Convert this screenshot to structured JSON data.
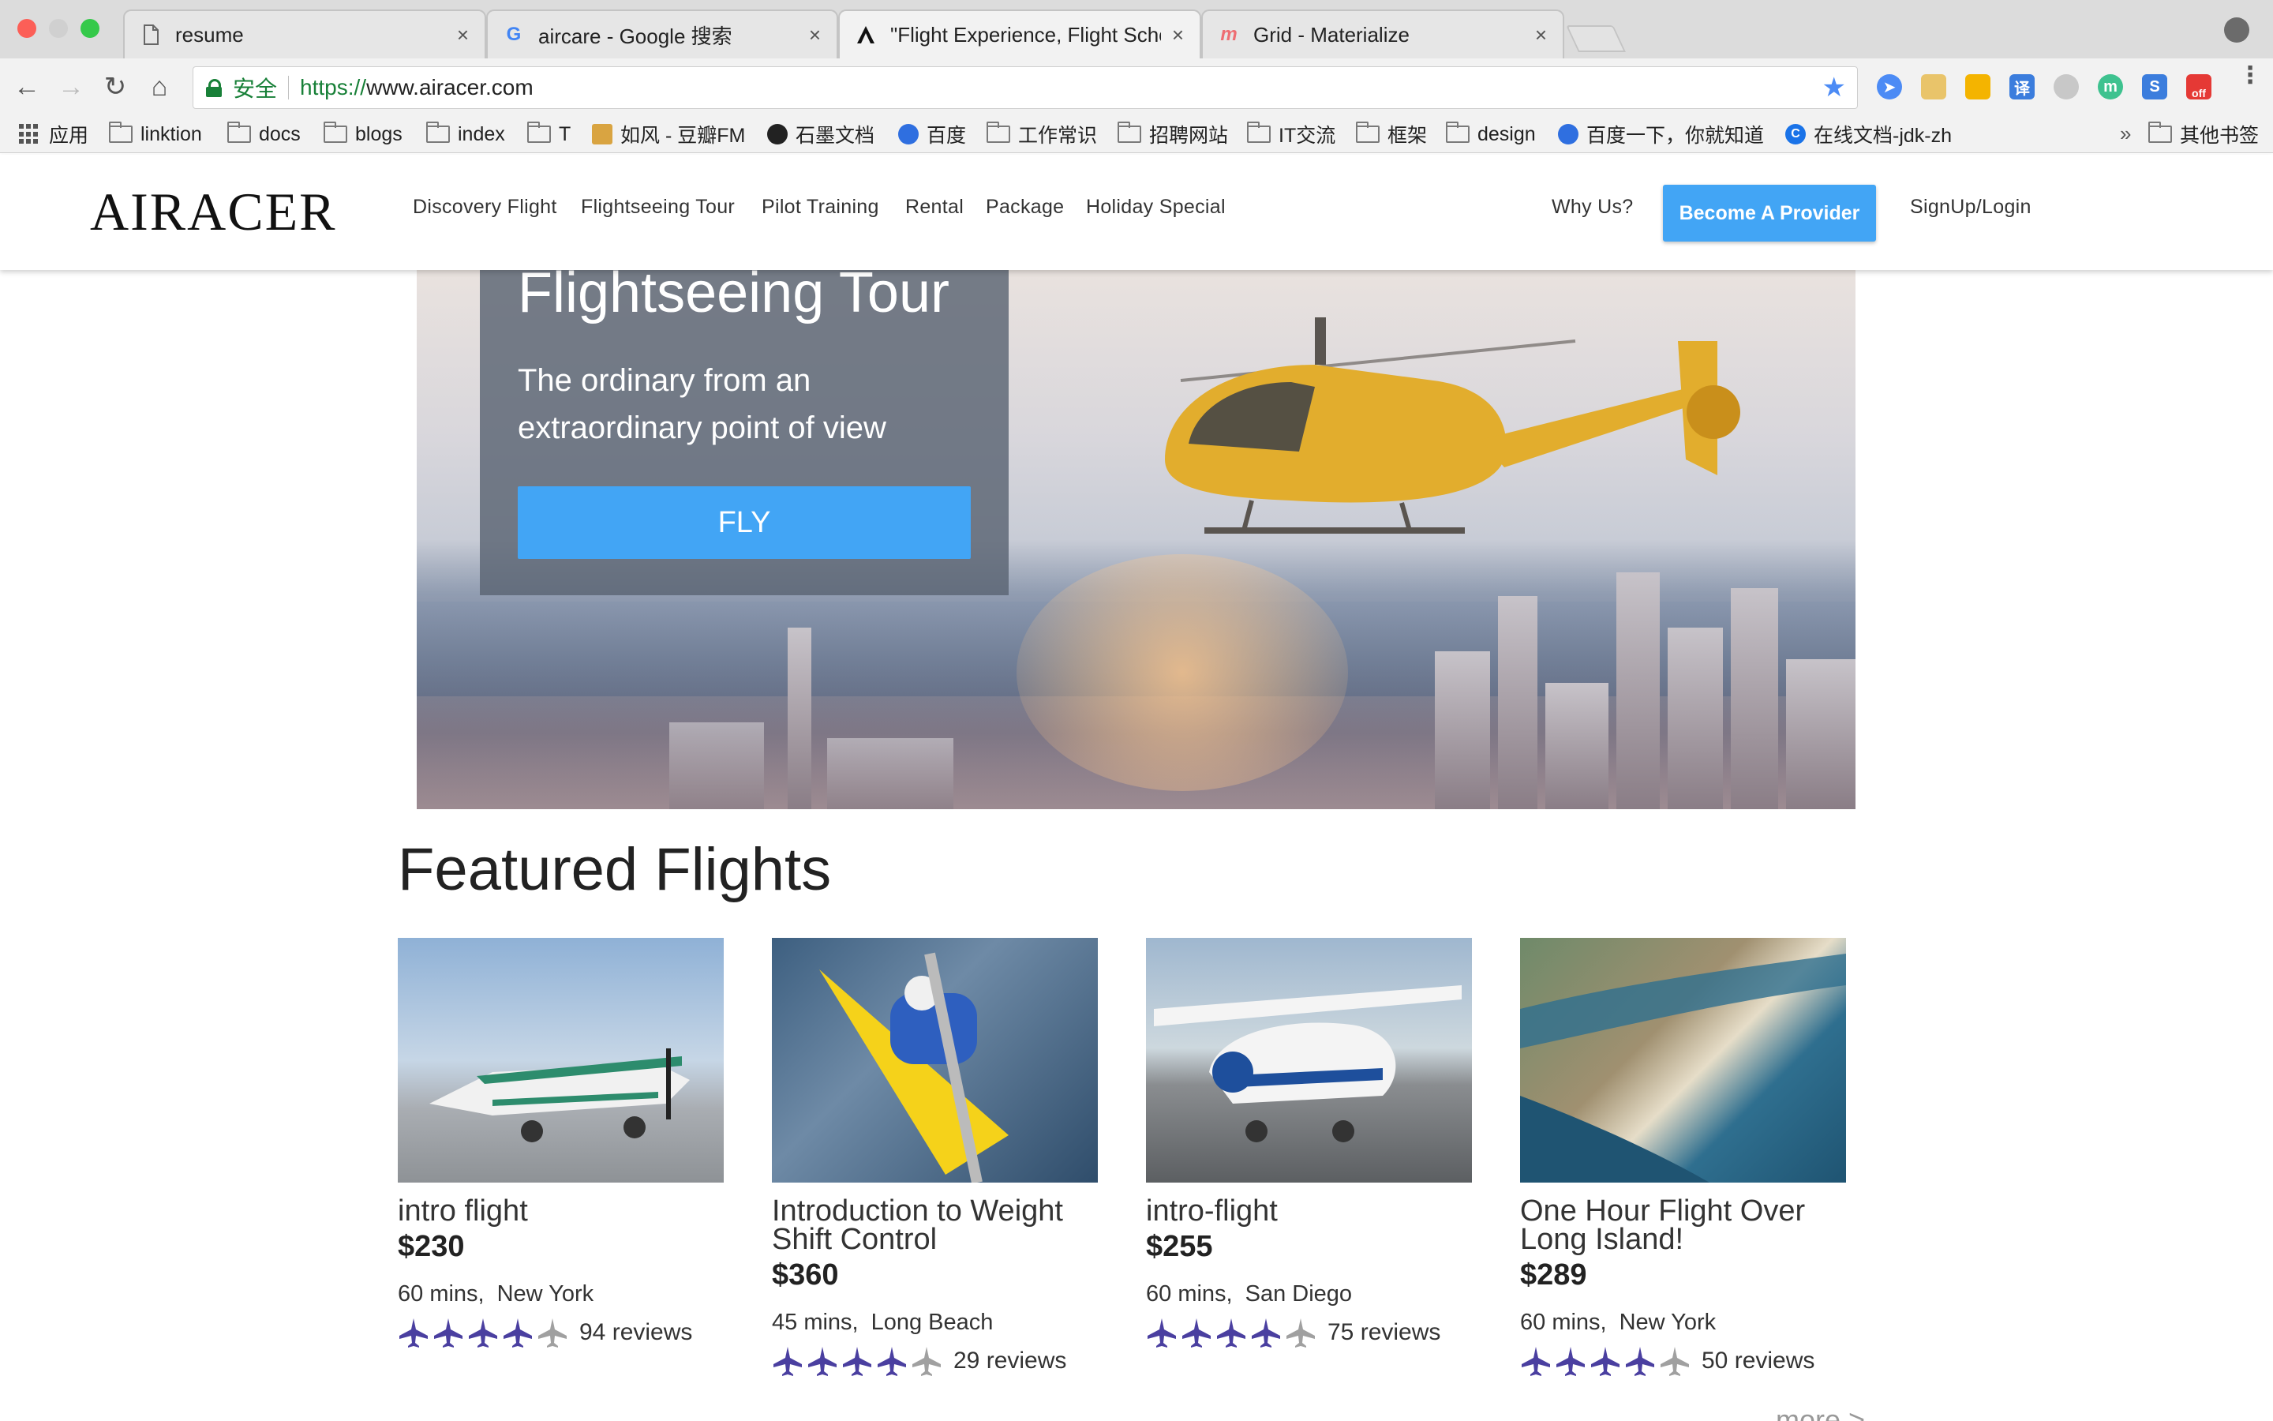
{
  "browser": {
    "tabs": [
      {
        "title": "resume",
        "icon": "document-icon",
        "close": "×"
      },
      {
        "title": "aircare - Google 搜索",
        "icon": "google-icon",
        "close": "×"
      },
      {
        "title": "\"Flight Experience, Flight Scho",
        "icon": "airacer-icon",
        "close": "×"
      },
      {
        "title": "Grid - Materialize",
        "icon": "materialize-icon",
        "close": "×"
      }
    ],
    "secure_label": "安全",
    "url_scheme": "https://",
    "url_host": "www.airacer.com",
    "bookmarks": [
      {
        "label": "应用",
        "icon": "apps-grid-icon"
      },
      {
        "label": "linktion",
        "icon": "folder-icon"
      },
      {
        "label": "docs",
        "icon": "folder-icon"
      },
      {
        "label": "blogs",
        "icon": "folder-icon"
      },
      {
        "label": "index",
        "icon": "folder-icon"
      },
      {
        "label": "T",
        "icon": "folder-icon"
      },
      {
        "label": "如风 - 豆瓣FM",
        "icon": "douban-icon"
      },
      {
        "label": "石墨文档",
        "icon": "shimo-icon"
      },
      {
        "label": "百度",
        "icon": "baidu-icon"
      },
      {
        "label": "工作常识",
        "icon": "folder-icon"
      },
      {
        "label": "招聘网站",
        "icon": "folder-icon"
      },
      {
        "label": "IT交流",
        "icon": "folder-icon"
      },
      {
        "label": "框架",
        "icon": "folder-icon"
      },
      {
        "label": "design",
        "icon": "folder-icon"
      },
      {
        "label": "百度一下，你就知道",
        "icon": "baidu-icon"
      },
      {
        "label": "在线文档-jdk-zh",
        "icon": "chrome-c-icon"
      }
    ],
    "bookmarks_more": "»",
    "other_bookmarks": "其他书签",
    "ext_off_badge": "off",
    "ext_translate": "译"
  },
  "site": {
    "logo": "AIRACER",
    "nav": [
      "Discovery Flight",
      "Flightseeing Tour",
      "Pilot Training",
      "Rental",
      "Package",
      "Holiday Special"
    ],
    "why_us": "Why Us?",
    "provider_button": "Become A Provider",
    "signup": "SignUp/Login"
  },
  "hero": {
    "title": "Flightseeing Tour",
    "subtitle": "The ordinary from an extraordinary point of view",
    "button": "FLY"
  },
  "featured": {
    "title": "Featured Flights",
    "cards": [
      {
        "title": "intro flight",
        "price": "$230",
        "duration": "60 mins,",
        "location": "New York",
        "rating": 4,
        "reviews": "94 reviews"
      },
      {
        "title": "Introduction to Weight Shift Control",
        "price": "$360",
        "duration": "45 mins,",
        "location": "Long Beach",
        "rating": 4,
        "reviews": "29 reviews"
      },
      {
        "title": "intro-flight",
        "price": "$255",
        "duration": "60 mins,",
        "location": "San Diego",
        "rating": 4,
        "reviews": "75 reviews"
      },
      {
        "title": "One Hour Flight Over Long Island!",
        "price": "$289",
        "duration": "60 mins,",
        "location": "New York",
        "rating": 4,
        "reviews": "50 reviews"
      }
    ],
    "more": "more >"
  },
  "colors": {
    "accent": "#42a5f5",
    "star_filled": "#4a3fa0",
    "star_empty": "#a0a0a0",
    "secure_green": "#188038"
  }
}
